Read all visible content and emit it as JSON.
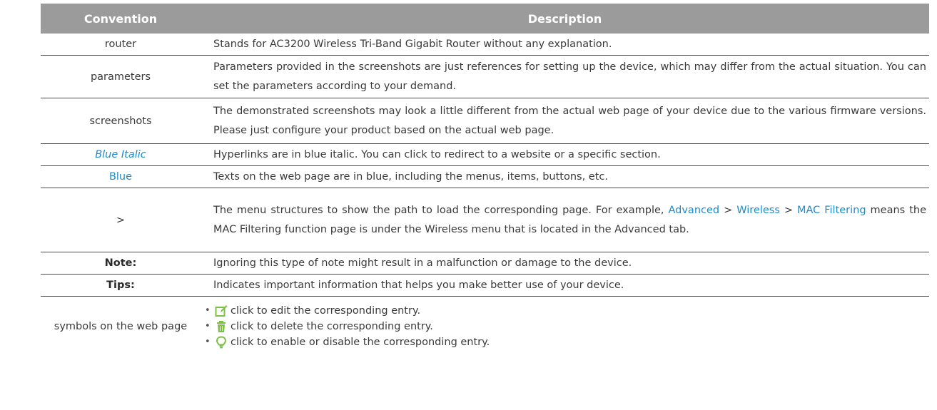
{
  "header": {
    "convention": "Convention",
    "description": "Description"
  },
  "rows": [
    {
      "convention": "router",
      "description": "Stands for AC3200 Wireless Tri-Band Gigabit Router without any explanation."
    },
    {
      "convention": "parameters",
      "description": "Parameters provided in the screenshots are just references for setting up the device, which may differ from the actual situation. You can set the parameters according to your demand."
    },
    {
      "convention": "screenshots",
      "description": "The demonstrated screenshots may look a little different from the actual web page of your device due to the various firmware versions. Please just configure your product based on the actual web page."
    },
    {
      "convention": "Blue Italic",
      "description": "Hyperlinks are in blue italic. You can click to redirect to a website or a specific section."
    },
    {
      "convention": "Blue",
      "description": "Texts on the web page are in blue, including the menus, items, buttons, etc."
    },
    {
      "convention": ">",
      "description_before": "The menu structures to show the path to load the corresponding page. For example, ",
      "link1": "Advanced",
      "sep1": " > ",
      "link2": "Wireless",
      "sep2": " > ",
      "link3": "MAC Filtering",
      "description_after": " means the MAC Filtering function page is under the Wireless menu that is located in the Advanced tab."
    },
    {
      "convention": "Note:",
      "description": "Ignoring this type of note might result in a malfunction or damage to the device."
    },
    {
      "convention": "Tips:",
      "description": "Indicates important information that helps you make better use of your device."
    },
    {
      "convention": "symbols on the web page",
      "symbols": [
        {
          "icon": "edit-icon",
          "bullet": "•",
          "text": "click to edit the corresponding entry."
        },
        {
          "icon": "trash-icon",
          "bullet": "•",
          "text": "click to delete the corresponding entry."
        },
        {
          "icon": "bulb-icon",
          "bullet": "•",
          "text": "click to enable or disable the corresponding entry."
        }
      ]
    }
  ],
  "colors": {
    "header_bg": "#9b9b9b",
    "link_blue": "#1e8bc9",
    "icon_green": "#7cc142",
    "text": "#3a3a3a"
  }
}
